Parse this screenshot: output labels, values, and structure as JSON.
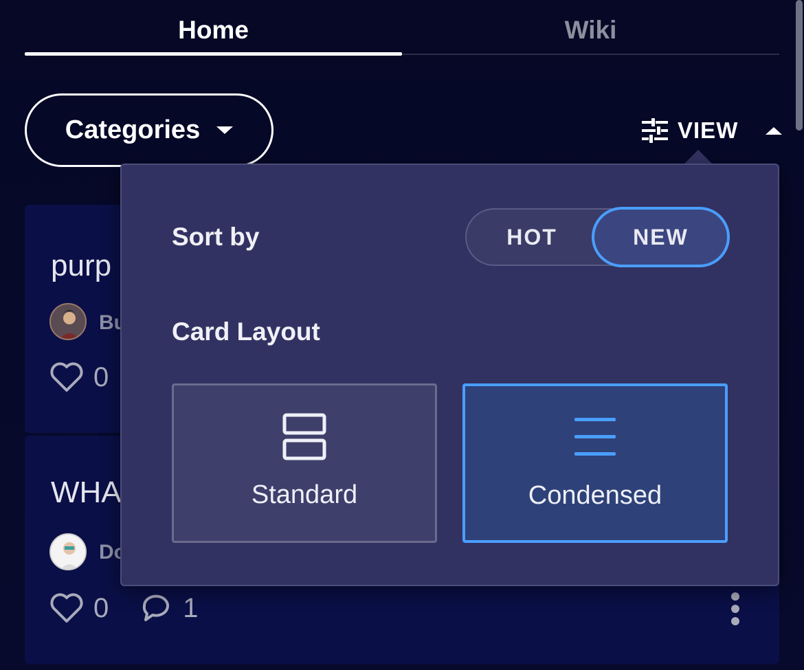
{
  "tabs": [
    {
      "label": "Home",
      "active": true
    },
    {
      "label": "Wiki",
      "active": false
    }
  ],
  "toolbar": {
    "categories_label": "Categories",
    "view_label": "VIEW"
  },
  "posts": [
    {
      "title": "purp",
      "author": "Bu",
      "likes": "0",
      "comments": ""
    },
    {
      "title": "WHA",
      "author": "Do",
      "likes": "0",
      "comments": "1"
    }
  ],
  "popover": {
    "sort_label": "Sort by",
    "sort_options": [
      {
        "label": "HOT",
        "selected": false
      },
      {
        "label": "NEW",
        "selected": true
      }
    ],
    "layout_label": "Card Layout",
    "layout_options": [
      {
        "label": "Standard",
        "icon": "standard-layout-icon",
        "selected": false
      },
      {
        "label": "Condensed",
        "icon": "condensed-layout-icon",
        "selected": true
      }
    ]
  },
  "colors": {
    "background": "#070a29",
    "card": "#0a0f47",
    "popover": "#323262",
    "accent": "#4a9eff"
  }
}
